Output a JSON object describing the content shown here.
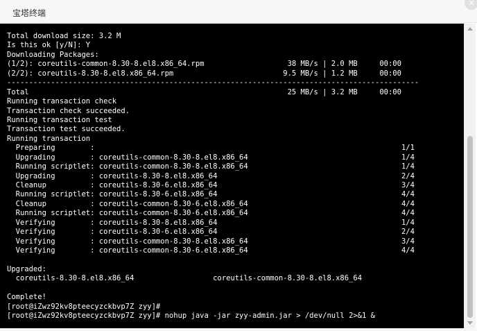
{
  "window": {
    "title": "宝塔终端",
    "close_label": "×"
  },
  "terminal": {
    "lines": [
      "Total download size: 3.2 M",
      "Is this ok [y/N]: Y",
      "Downloading Packages:",
      "(1/2): coreutils-common-8.30-8.el8.x86_64.rpm                   38 MB/s | 2.0 MB     00:00",
      "(2/2): coreutils-8.30-8.el8.x86_64.rpm                         9.5 MB/s | 1.2 MB     00:00",
      "----------------------------------------------------------------------------------------------",
      "Total                                                           25 MB/s | 3.2 MB     00:00",
      "Running transaction check",
      "Transaction check succeeded.",
      "Running transaction test",
      "Transaction test succeeded.",
      "Running transaction",
      "  Preparing        :                                                                      1/1",
      "  Upgrading        : coreutils-common-8.30-8.el8.x86_64                                   1/4",
      "  Running scriptlet: coreutils-common-8.30-8.el8.x86_64                                   1/4",
      "  Upgrading        : coreutils-8.30-8.el8.x86_64                                          2/4",
      "  Cleanup          : coreutils-8.30-6.el8.x86_64                                          3/4",
      "  Running scriptlet: coreutils-8.30-6.el8.x86_64                                          4/4",
      "  Cleanup          : coreutils-common-8.30-6.el8.x86_64                                   4/4",
      "  Running scriptlet: coreutils-common-8.30-6.el8.x86_64                                   4/4",
      "  Verifying        : coreutils-8.30-8.el8.x86_64                                          1/4",
      "  Verifying        : coreutils-8.30-6.el8.x86_64                                          2/4",
      "  Verifying        : coreutils-common-8.30-8.el8.x86_64                                   3/4",
      "  Verifying        : coreutils-common-8.30-6.el8.x86_64                                   4/4",
      "",
      "Upgraded:",
      "  coreutils-8.30-8.el8.x86_64                  coreutils-common-8.30-8.el8.x86_64",
      "",
      "Complete!",
      "[root@iZwz92kv8pteecyzckbvp7Z zyy]#",
      "[root@iZwz92kv8pteecyzckbvp7Z zyy]# nohup java -jar zyy-admin.jar > /dev/null 2>&1 &"
    ]
  }
}
